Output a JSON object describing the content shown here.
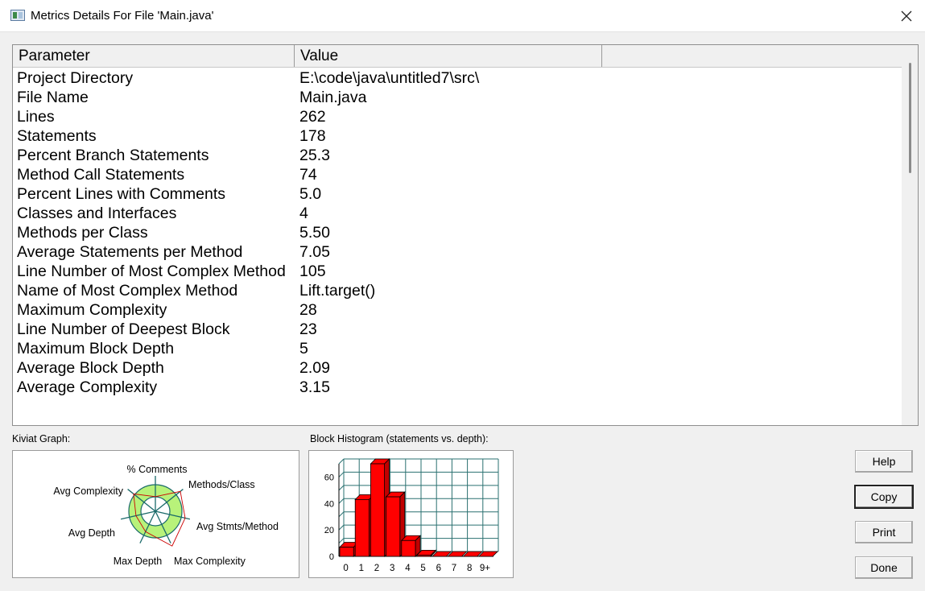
{
  "window": {
    "title": "Metrics Details For File 'Main.java'"
  },
  "table": {
    "columns": [
      "Parameter",
      "Value",
      ""
    ],
    "rows": [
      {
        "parameter": "Project Directory",
        "value": "E:\\code\\java\\untitled7\\src\\"
      },
      {
        "parameter": "File Name",
        "value": "Main.java"
      },
      {
        "parameter": "Lines",
        "value": "262"
      },
      {
        "parameter": "Statements",
        "value": "178"
      },
      {
        "parameter": "Percent Branch Statements",
        "value": "25.3"
      },
      {
        "parameter": "Method Call Statements",
        "value": "74"
      },
      {
        "parameter": "Percent Lines with Comments",
        "value": "5.0"
      },
      {
        "parameter": "Classes and Interfaces",
        "value": "4"
      },
      {
        "parameter": "Methods per Class",
        "value": "5.50"
      },
      {
        "parameter": "Average Statements per Method",
        "value": "7.05"
      },
      {
        "parameter": "Line Number of Most Complex Method",
        "value": "105"
      },
      {
        "parameter": "Name of Most Complex Method",
        "value": "Lift.target()"
      },
      {
        "parameter": "Maximum Complexity",
        "value": "28"
      },
      {
        "parameter": "Line Number of Deepest Block",
        "value": "23"
      },
      {
        "parameter": "Maximum Block Depth",
        "value": "5"
      },
      {
        "parameter": "Average Block Depth",
        "value": "2.09"
      },
      {
        "parameter": "Average Complexity",
        "value": "3.15"
      }
    ]
  },
  "kiviat": {
    "label": "Kiviat Graph:",
    "axes": [
      "% Comments",
      "Methods/Class",
      "Avg Stmts/Method",
      "Max Complexity",
      "Max Depth",
      "Avg Depth",
      "Avg Complexity"
    ],
    "colors": {
      "band": "#b8f27a",
      "spokes": "#1a6a6a",
      "values": "#cc0000"
    }
  },
  "histogram": {
    "label": "Block Histogram (statements vs. depth):",
    "colors": {
      "bar": "#ff0000",
      "grid": "#2a7070"
    }
  },
  "chart_data": {
    "type": "bar",
    "title": "Block Histogram (statements vs. depth):",
    "categories": [
      "0",
      "1",
      "2",
      "3",
      "4",
      "5",
      "6",
      "7",
      "8",
      "9+"
    ],
    "values": [
      7,
      43,
      70,
      45,
      12,
      1,
      0,
      0,
      0,
      0
    ],
    "yticks": [
      "0",
      "20",
      "40",
      "60"
    ],
    "ylim": [
      0,
      70
    ]
  },
  "buttons": {
    "help": "Help",
    "copy": "Copy",
    "print": "Print",
    "done": "Done"
  }
}
